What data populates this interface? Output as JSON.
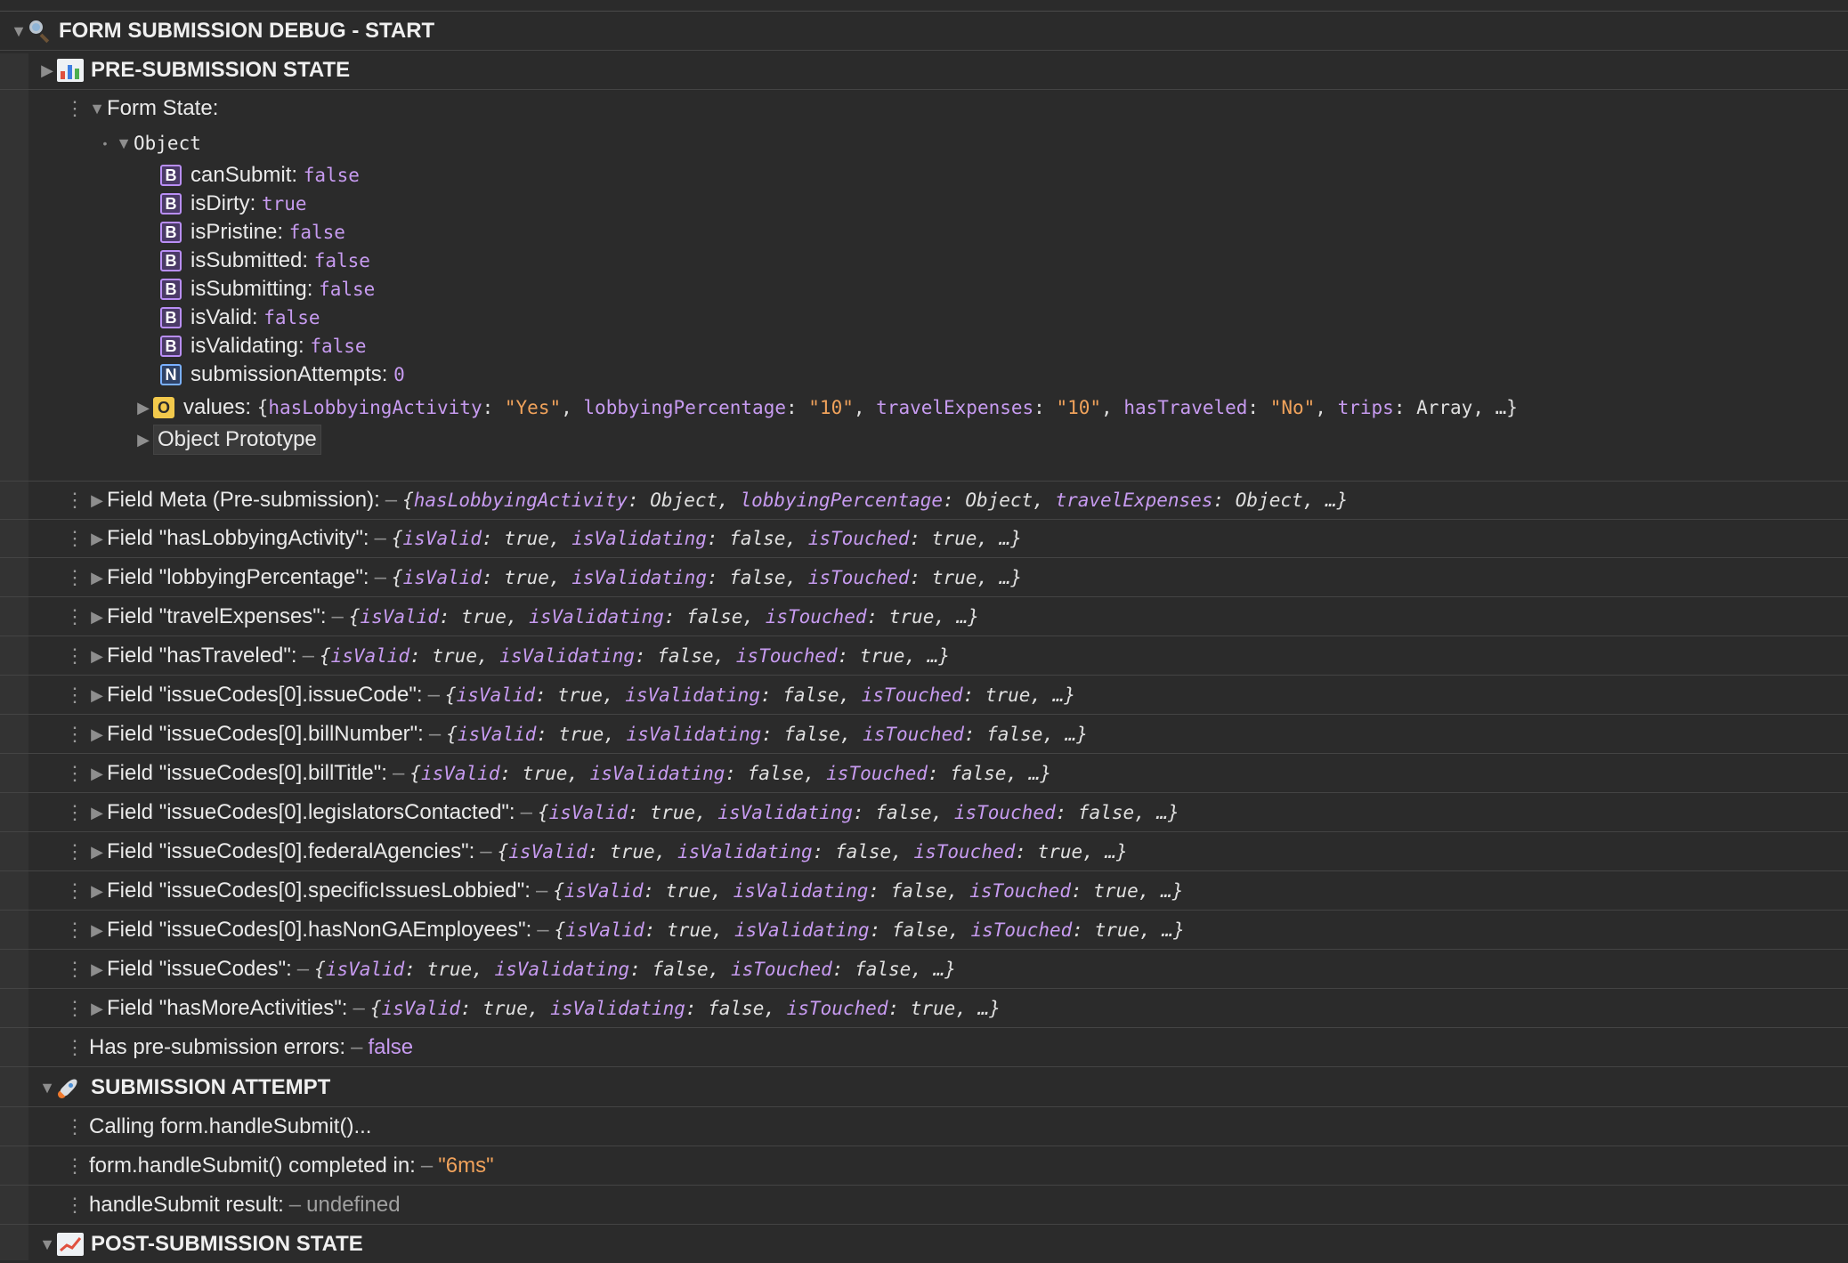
{
  "groups": {
    "main": {
      "title": "FORM SUBMISSION DEBUG - START",
      "icon": "magnifying-glass-icon"
    },
    "pre": {
      "title": "PRE-SUBMISSION STATE",
      "icon": "bar-chart-icon"
    },
    "attempt": {
      "title": "SUBMISSION ATTEMPT",
      "icon": "rocket-icon"
    },
    "post": {
      "title": "POST-SUBMISSION STATE",
      "icon": "chart-increasing-icon"
    }
  },
  "form_state": {
    "label": "Form State:",
    "object_label": "Object",
    "props": [
      {
        "type": "B",
        "key": "canSubmit",
        "value": "false"
      },
      {
        "type": "B",
        "key": "isDirty",
        "value": "true"
      },
      {
        "type": "B",
        "key": "isPristine",
        "value": "false"
      },
      {
        "type": "B",
        "key": "isSubmitted",
        "value": "false"
      },
      {
        "type": "B",
        "key": "isSubmitting",
        "value": "false"
      },
      {
        "type": "B",
        "key": "isValid",
        "value": "false"
      },
      {
        "type": "B",
        "key": "isValidating",
        "value": "false"
      },
      {
        "type": "N",
        "key": "submissionAttempts",
        "value": "0"
      }
    ],
    "values": {
      "type": "O",
      "key": "values",
      "pairs": [
        {
          "k": "hasLobbyingActivity",
          "v": "\"Yes\""
        },
        {
          "k": "lobbyingPercentage",
          "v": "\"10\""
        },
        {
          "k": "travelExpenses",
          "v": "\"10\""
        },
        {
          "k": "hasTraveled",
          "v": "\"No\""
        },
        {
          "k": "trips",
          "v": "Array"
        }
      ],
      "tail": "…}"
    },
    "prototype_label": "Object Prototype"
  },
  "field_meta": {
    "label": "Field Meta (Pre-submission):",
    "pairs": [
      {
        "k": "hasLobbyingActivity",
        "v": "Object"
      },
      {
        "k": "lobbyingPercentage",
        "v": "Object"
      },
      {
        "k": "travelExpenses",
        "v": "Object"
      }
    ]
  },
  "fields": [
    {
      "label": "Field \"hasLobbyingActivity\":",
      "isTouched": "true"
    },
    {
      "label": "Field \"lobbyingPercentage\":",
      "isTouched": "true"
    },
    {
      "label": "Field \"travelExpenses\":",
      "isTouched": "true"
    },
    {
      "label": "Field \"hasTraveled\":",
      "isTouched": "true"
    },
    {
      "label": "Field \"issueCodes[0].issueCode\":",
      "isTouched": "true"
    },
    {
      "label": "Field \"issueCodes[0].billNumber\":",
      "isTouched": "false"
    },
    {
      "label": "Field \"issueCodes[0].billTitle\":",
      "isTouched": "false"
    },
    {
      "label": "Field \"issueCodes[0].legislatorsContacted\":",
      "isTouched": "false"
    },
    {
      "label": "Field \"issueCodes[0].federalAgencies\":",
      "isTouched": "true"
    },
    {
      "label": "Field \"issueCodes[0].specificIssuesLobbied\":",
      "isTouched": "true"
    },
    {
      "label": "Field \"issueCodes[0].hasNonGAEmployees\":",
      "isTouched": "true"
    },
    {
      "label": "Field \"issueCodes\":",
      "isTouched": "false"
    },
    {
      "label": "Field \"hasMoreActivities\":",
      "isTouched": "true"
    }
  ],
  "field_common": {
    "isValid": "true",
    "isValidating": "false"
  },
  "pre_errors": {
    "label": "Has pre-submission errors:",
    "value": "false"
  },
  "attempt_logs": {
    "calling": "Calling form.handleSubmit()...",
    "completed_label": "form.handleSubmit() completed in:",
    "completed_value": "\"6ms\"",
    "result_label": "handleSubmit result:",
    "result_value": "undefined"
  },
  "colors": {
    "background": "#2b2b2b",
    "key": "#c79bf0",
    "string": "#f0a25b",
    "badge_boolean": "#b98ef5",
    "badge_number": "#7ab0ff",
    "badge_object": "#f2c94c"
  }
}
